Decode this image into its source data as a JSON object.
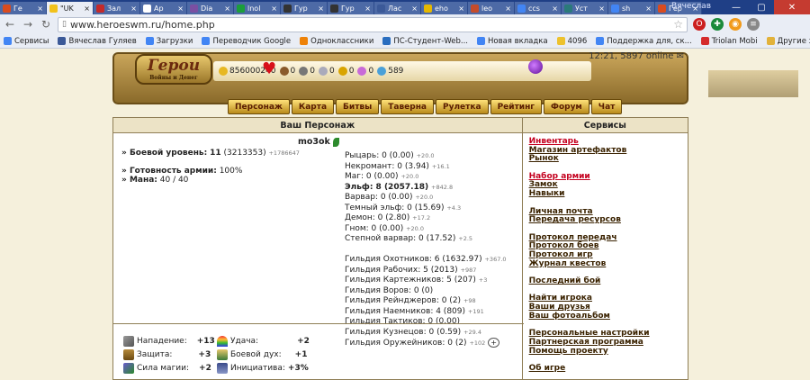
{
  "browser": {
    "tabs": [
      {
        "label": "Ге",
        "fav": "#d94b1f"
      },
      {
        "label": "\"UK",
        "fav": "#f2c21b"
      },
      {
        "label": "Зал",
        "fav": "#c52a2a"
      },
      {
        "label": "Ар",
        "fav": "#ffffff"
      },
      {
        "label": "Dia",
        "fav": "#7a4fa2"
      },
      {
        "label": "lnol",
        "fav": "#1b9e3a"
      },
      {
        "label": "Гур",
        "fav": "#333333"
      },
      {
        "label": "Гур",
        "fav": "#333333"
      },
      {
        "label": "Лас",
        "fav": "#3b5998"
      },
      {
        "label": "eho",
        "fav": "#e6b800"
      },
      {
        "label": "leo",
        "fav": "#c54b2a"
      },
      {
        "label": "ccs",
        "fav": "#4285f4"
      },
      {
        "label": "Уст",
        "fav": "#2a7a7a"
      },
      {
        "label": "sh",
        "fav": "#4285f4"
      },
      {
        "label": "Гер",
        "fav": "#d94b1f"
      }
    ],
    "window_title": "Вячеслав",
    "url": "www.heroeswm.ru/home.php",
    "bookmarks": [
      {
        "label": "Сервисы",
        "fav": "#4285f4"
      },
      {
        "label": "Вячеслав Гуляев",
        "fav": "#3b5998"
      },
      {
        "label": "Загрузки",
        "fav": "#4285f4"
      },
      {
        "label": "Переводчик Google",
        "fav": "#4285f4"
      },
      {
        "label": "Одноклассники",
        "fav": "#ee8208"
      },
      {
        "label": "ПС-Студент-Web...",
        "fav": "#2a6ebf"
      },
      {
        "label": "Новая вкладка",
        "fav": "#4285f4"
      },
      {
        "label": "4096",
        "fav": "#edc22e"
      },
      {
        "label": "Поддержка для, ск...",
        "fav": "#4285f4"
      },
      {
        "label": "Triolan Mobi",
        "fav": "#d52b2b"
      }
    ],
    "other_bookmarks": "Другие закладки"
  },
  "header": {
    "logo_title": "Герои",
    "logo_subtitle": "Войны и Денег",
    "clock": "12:21, 5897 online",
    "resources": {
      "gold": "856000240",
      "wood": "0",
      "ore": "0",
      "mercury": "0",
      "sulfur": "0",
      "crystal": "0",
      "gems": "589"
    },
    "menu": [
      "Персонаж",
      "Карта",
      "Битвы",
      "Таверна",
      "Рулетка",
      "Рейтинг",
      "Форум",
      "Чат"
    ]
  },
  "character": {
    "section_title": "Ваш Персонаж",
    "name": "mo3ok",
    "combat_level_label": "» Боевой уровень:",
    "combat_level": "11",
    "combat_exp": "(3213353)",
    "combat_exp_gain": "+1786647",
    "army_ready_label": "» Готовность армии:",
    "army_ready": "100%",
    "mana_label": "» Мана:",
    "mana": "40 / 40",
    "factions": [
      {
        "label": "Рыцарь: 0 (0.00)",
        "gain": "+20.0"
      },
      {
        "label": "Некромант: 0 (3.94)",
        "gain": "+16.1"
      },
      {
        "label": "Маг: 0 (0.00)",
        "gain": "+20.0"
      },
      {
        "label": "Эльф: 8 (2057.18)",
        "gain": "+842.8",
        "bold": true
      },
      {
        "label": "Варвар: 0 (0.00)",
        "gain": "+20.0"
      },
      {
        "label": "Темный эльф: 0 (15.69)",
        "gain": "+4.3"
      },
      {
        "label": "Демон: 0 (2.80)",
        "gain": "+17.2"
      },
      {
        "label": "Гном: 0 (0.00)",
        "gain": "+20.0"
      },
      {
        "label": "Степной варвар: 0 (17.52)",
        "gain": "+2.5"
      }
    ],
    "guilds": [
      {
        "label": "Гильдия Охотников: 6 (1632.97)",
        "gain": "+367.0"
      },
      {
        "label": "Гильдия Рабочих: 5 (2013)",
        "gain": "+987"
      },
      {
        "label": "Гильдия Картежников: 5 (207)",
        "gain": "+3"
      },
      {
        "label": "Гильдия Воров: 0 (0)",
        "gain": ""
      },
      {
        "label": "Гильдия Рейнджеров: 0 (2)",
        "gain": "+98"
      },
      {
        "label": "Гильдия Наемников: 4 (809)",
        "gain": "+191"
      },
      {
        "label": "Гильдия Тактиков: 0 (0.00)",
        "gain": ""
      },
      {
        "label": "Гильдия Кузнецов: 0 (0.59)",
        "gain": "+29.4"
      },
      {
        "label": "Гильдия Оружейников: 0 (2)",
        "gain": "+102"
      }
    ],
    "guild_plus": "+",
    "stats": {
      "attack_label": "Нападение:",
      "attack": "+13",
      "defense_label": "Защита:",
      "defense": "+3",
      "magic_label": "Сила магии:",
      "magic": "+2",
      "luck_label": "Удача:",
      "luck": "+2",
      "morale_label": "Боевой дух:",
      "morale": "+1",
      "initiative_label": "Инициатива:",
      "initiative": "+3%"
    }
  },
  "services": {
    "section_title": "Сервисы",
    "groups": [
      [
        {
          "label": "Инвентарь",
          "red": true
        },
        {
          "label": "Магазин артефактов"
        },
        {
          "label": "Рынок"
        }
      ],
      [
        {
          "label": "Набор армии",
          "red": true
        },
        {
          "label": "Замок"
        },
        {
          "label": "Навыки"
        }
      ],
      [
        {
          "label": "Личная почта"
        },
        {
          "label": "Передача ресурсов"
        }
      ],
      [
        {
          "label": "Протокол передач"
        },
        {
          "label": "Протокол боев"
        },
        {
          "label": "Протокол игр"
        },
        {
          "label": "Журнал квестов"
        }
      ],
      [
        {
          "label": "Последний бой"
        }
      ],
      [
        {
          "label": "Найти игрока"
        },
        {
          "label": "Ваши друзья"
        },
        {
          "label": "Ваш фотоальбом"
        }
      ],
      [
        {
          "label": "Персональные настройки"
        },
        {
          "label": "Партнерская программа"
        },
        {
          "label": "Помощь проекту"
        }
      ],
      [
        {
          "label": "Об игре"
        }
      ]
    ]
  }
}
